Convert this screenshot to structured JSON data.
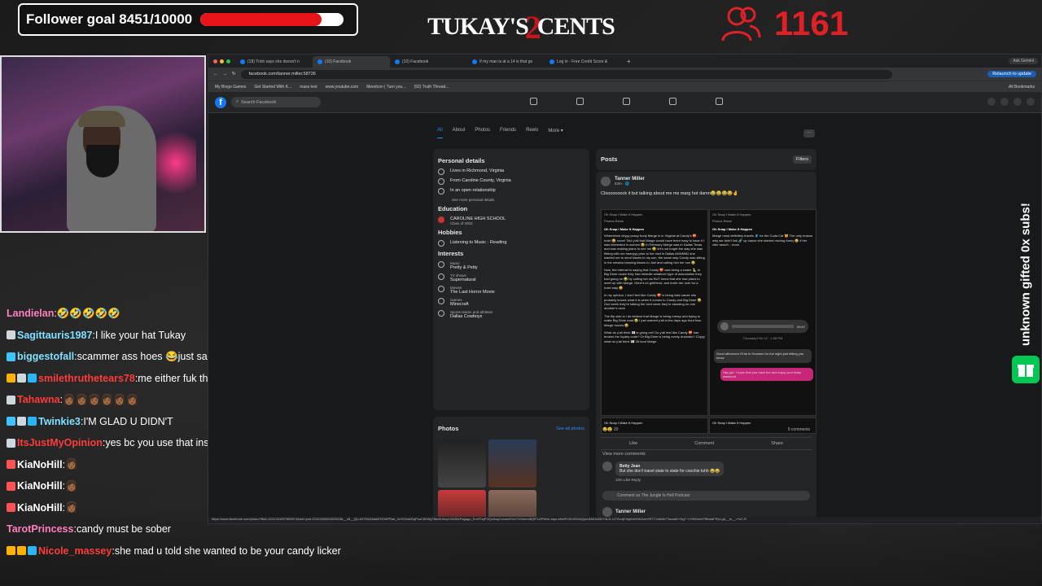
{
  "overlay": {
    "follower_goal_label": "Follower goal 8451/10000",
    "follower_current": 8451,
    "follower_target": 10000,
    "logo_text_left": "TUKAY'S",
    "logo_text_num": "2",
    "logo_text_right": "CENTS",
    "viewer_count": "1161",
    "gift_text": "unknown gifted 0x subs!",
    "accent_red": "#e02027",
    "gift_green": "#00c853"
  },
  "chat": [
    {
      "user": "Landielan",
      "text": " 🤣🤣🤣🤣🤣",
      "color": "#ff7fbf",
      "badges": []
    },
    {
      "user": "Sagittauris1987",
      "text": " I like your hat Tukay",
      "color": "#7fe0ff",
      "badges": [
        "#cfd8dc"
      ]
    },
    {
      "user": "biggestofall",
      "text": " scammer ass hoes 😂just sad",
      "color": "#7fe0ff",
      "badges": [
        "#40c4ff"
      ]
    },
    {
      "user": "smilethruthetears78",
      "text": " me either fuk that",
      "color": "#ff3b3b",
      "badges": [
        "#ffb300",
        "#cfd8dc",
        "#29b6f6"
      ]
    },
    {
      "user": "Tahawna",
      "text": " 👩🏾👩🏾👩🏾👩🏾👩🏾👩🏾",
      "color": "#ff3b3b",
      "badges": [
        "#cfd8dc"
      ]
    },
    {
      "user": "Twinkie3",
      "text": " I'M GLAD U DIDN'T",
      "color": "#7fe0ff",
      "badges": [
        "#40c4ff",
        "#cfd8dc",
        "#29b6f6"
      ]
    },
    {
      "user": "ItsJustMyOpinion",
      "text": " yes bc you use that instead of Ozempic",
      "color": "#ff3b3b",
      "badges": [
        "#cfd8dc"
      ]
    },
    {
      "user": "KiaNoHill",
      "text": " 👩🏾",
      "color": "#ffffff",
      "badges": [
        "#ff5252"
      ]
    },
    {
      "user": "KiaNoHill",
      "text": " 👩🏾",
      "color": "#ffffff",
      "badges": [
        "#ff5252"
      ]
    },
    {
      "user": "KiaNoHill",
      "text": " 👩🏾",
      "color": "#ffffff",
      "badges": [
        "#ff5252"
      ]
    },
    {
      "user": "TarotPrincess",
      "text": " candy must be sober",
      "color": "#ff7fbf",
      "badges": []
    },
    {
      "user": "Nicole_massey",
      "text": " she mad u told she wanted to be your candy licker",
      "color": "#ff3b3b",
      "badges": [
        "#ffb300",
        "#ffb300",
        "#29b6f6"
      ]
    }
  ],
  "browser": {
    "tabs": [
      {
        "label": "(18) Trish says she doesn't n",
        "active": false
      },
      {
        "label": "(10) Facebook",
        "active": true
      },
      {
        "label": "(10) Facebook",
        "active": false
      },
      {
        "label": "If my man is at a 14 is that go",
        "active": false
      },
      {
        "label": "Log in - Free Credit Score & ",
        "active": false
      }
    ],
    "new_tab": "+",
    "ask_gemini": "Ask Gemini",
    "url": "facebook.com/tanner.miller.58726",
    "relaunch": "Relaunch to update",
    "bookmarks": [
      "My Bingo Games",
      "Get Started With K...",
      "mass text",
      "www.youtube.com",
      "Meedcon | Turn you...",
      "(92) Truth Thread..."
    ],
    "all_bookmarks": "All Bookmarks",
    "status_url": "https://www.facebook.com/photo/?fbid=2231331997605974&set=pcb.2231335609392518&__cft__[0]=AZYBkZAaikEDOAPRae_4xYtOcdvDqPsuC8ZWg78bc5rIhuy14f438ePagago_EmfT0qPGQo0wp2omaW%nYVStmemB(5PU2PWxh-eqw-zMcIPvSU05XAQysv3A0Ju8E/Y3LD-LDTIed)K0ip6dhSWJizeGRTT2AbNK73sraa5Y2tg7~vY9W4eM7fBbddFtFpi.g&__tn__=*bC-R"
  },
  "facebook": {
    "search_placeholder": "Search Facebook",
    "profile_tabs": [
      "All",
      "About",
      "Photos",
      "Friends",
      "Reels",
      "More ▾"
    ],
    "more_dots": "···",
    "personal_details_title": "Personal details",
    "personal": [
      {
        "text": "Lives in Richmond, Virginia"
      },
      {
        "text": "From Caroline County, Virginia"
      },
      {
        "text": "In an open relationship"
      }
    ],
    "see_more_details": "See more personal details",
    "education_title": "Education",
    "school": "CAROLINE HIGH SCHOOL",
    "school_sub": "Class of 2003",
    "hobbies_title": "Hobbies",
    "hobbies": "Listening to Music · Reading",
    "interests_title": "Interests",
    "interests": [
      {
        "cat": "Music",
        "val": "Pretty & Petty"
      },
      {
        "cat": "TV shows",
        "val": "Supernatural"
      },
      {
        "cat": "Movies",
        "val": "The Last Horror Movie"
      },
      {
        "cat": "Games",
        "val": "Minecraft"
      },
      {
        "cat": "Sports teams and athletes",
        "val": "Dallas Cowboys"
      }
    ],
    "photos_title": "Photos",
    "see_all_photos": "See all photos",
    "posts_title": "Posts",
    "filters": "Filters",
    "post": {
      "author": "Tanner Miller",
      "time": "53m · 🌐",
      "text": "Clooooooock it but talking about me ms marg hot damn😂😂😂😂✌",
      "shot_header": "Oh Snap I Make It Happen",
      "shot_tabs": "Photos   Reels",
      "left_para1": "Wheeeeew chyyy pussy body Marge is in Virginia at Candy's 🍑, hotel 😂 room! Told y'all that Marge would have been easy to have if I was interested in women 😂 In February Marge was in Dallas Texas and was making plans to see me 😂 let's not forget the way she was flirting with me heavyyy prior to her visit in Dallas ANNNND she wanted me to send kisses to my son, the same way Candy was sitting in the window blowing kisses to Joel and calling him her son 😂",
      "left_para2": "Now, the internet is saying that Candy 🍑 was being a snake 🐍 to Big Dime cause they had rekindle whatever type of association they had going on 😂 by calling her sis BUT knew that she had plans to meet up with Marge, Dime's ex girlfriend, and invite her over for a hotel stay 😂",
      "left_para3": "In my opinion, I don't feel like Candy 🍑 is being fake cause she probably knows what it is when it comes to Candy and Big Dime 😂 One week they're talking the next week they're standing on one another's neck",
      "left_para4": "The flip side is I do believe that Marge is being messy and trying to make Big Dime mad 😂 I just warned y'all a few days ago bout how Marge moves 😂",
      "left_para5": "What do y'all think 👀 is going on!! Do y'all feel like Candy 🍑 has broken the loyalty code? Or Big Dime is being overly dramatic? Chyyy what do y'all think 👀 35 bout Marge",
      "right_para": "Marge most definitely travels 🧳 for the Cuda Cat 🐱 The only reason why we didn't link 🔗 up cause she started moving funny 😂 if her vibe wasn't... more",
      "voice_time": "00:47",
      "date_stamp": "Thursday Feb 12 · 1:08 PM",
      "msg_in": "Good afternoon I'll be in Houston for the night just letting you know",
      "msg_out": "Hey girl, I hope that you have fun and enjoy your bday weekend",
      "reactions": "😂😮 20",
      "comment_count": "9 comments",
      "like": "Like",
      "comment": "Comment",
      "share": "Share",
      "view_more_comments": "View more comments",
      "commenter": "Betty Jean",
      "comment_text": "But she don't travel state to state for coochie tuhh 😂😂",
      "comment_meta": "10m   Like   Reply",
      "comment_placeholder": "Comment as The Jungle Is Hell Podcast",
      "next_author": "Tanner Miller"
    }
  }
}
